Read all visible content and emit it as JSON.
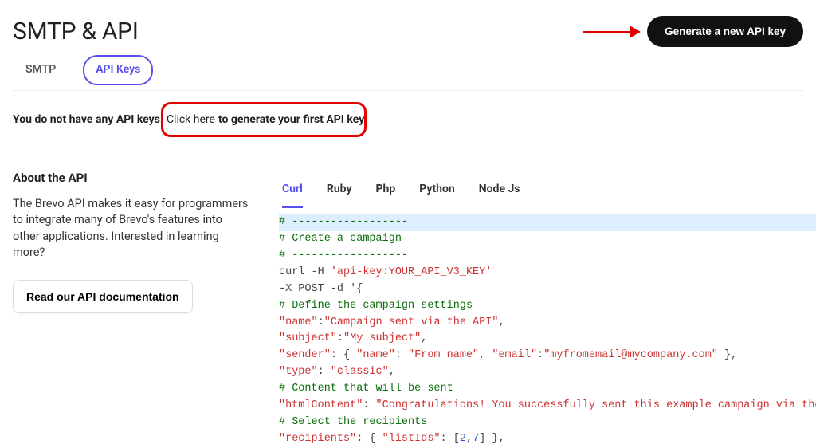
{
  "header": {
    "title": "SMTP & API",
    "generate_button": "Generate a new API key"
  },
  "tabs": [
    {
      "label": "SMTP",
      "active": false
    },
    {
      "label": "API Keys",
      "active": true
    }
  ],
  "notice": {
    "prefix": "You do not have any API keys.",
    "link": "Click here",
    "suffix": "to generate your first API key."
  },
  "about": {
    "title": "About the API",
    "body": "The Brevo API makes it easy for programmers to integrate many of Brevo's features into other applications. Interested in learning more?",
    "doc_button": "Read our API documentation"
  },
  "code_tabs": [
    "Curl",
    "Ruby",
    "Php",
    "Python",
    "Node Js"
  ],
  "code_tabs_active": "Curl",
  "code": {
    "c1": "# ------------------",
    "c2": "# Create a campaign",
    "c3": "# ------------------",
    "curl_prefix": "curl -H ",
    "curl_header": "'api-key:YOUR_API_V3_KEY'",
    "post_prefix": "-X POST -d '",
    "post_brace": "{",
    "c4": "# Define the campaign settings",
    "k_name": "\"name\"",
    "v_name": "\"Campaign sent via the API\"",
    "k_subject": "\"subject\"",
    "v_subject": "\"My subject\"",
    "k_sender": "\"sender\"",
    "sender_open": ": { ",
    "k_sname": "\"name\"",
    "v_sname": "\"From name\"",
    "k_semail": "\"email\"",
    "v_semail": "\"myfromemail@mycompany.com\"",
    "sender_close": " },",
    "k_type": "\"type\"",
    "v_type": "\"classic\"",
    "c5": "# Content that will be sent",
    "k_html": "\"htmlContent\"",
    "v_html": "\"Congratulations! You successfully sent this example campaign via the",
    "c6": "# Select the recipients",
    "k_recip": "\"recipients\"",
    "recip_mid": ": { ",
    "k_listids": "\"listIds\"",
    "listids_open": ": [",
    "n2": "2",
    "n7": "7",
    "listids_close": "] },"
  }
}
